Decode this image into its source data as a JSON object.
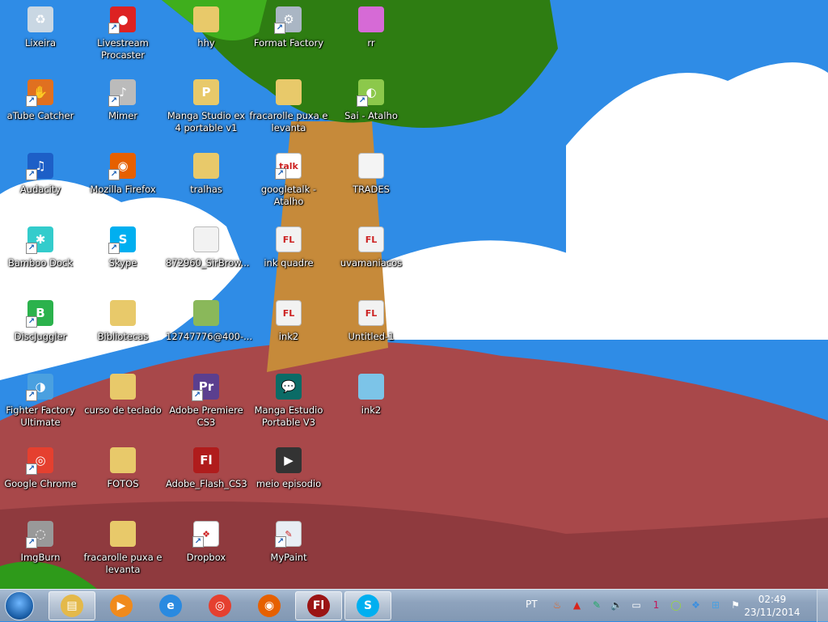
{
  "desktop": {
    "icons": [
      {
        "label": "Lixeira",
        "name": "recycle-bin",
        "color": "#c9d7e3",
        "glyph": "♻",
        "shortcut": false,
        "col": 0,
        "row": 0
      },
      {
        "label": "Livestream Procaster",
        "name": "livestream-procaster",
        "color": "#d22",
        "glyph": "●",
        "shortcut": true,
        "col": 1,
        "row": 0
      },
      {
        "label": "hhy",
        "name": "folder-hhy",
        "color": "#e8c96a",
        "glyph": "",
        "shortcut": false,
        "col": 2,
        "row": 0
      },
      {
        "label": "Format Factory",
        "name": "format-factory",
        "color": "#aab6c4",
        "glyph": "⚙",
        "shortcut": true,
        "col": 3,
        "row": 0
      },
      {
        "label": "rr",
        "name": "image-rr",
        "color": "#d66ad6",
        "glyph": "",
        "shortcut": false,
        "col": 4,
        "row": 0
      },
      {
        "label": "aTube Catcher",
        "name": "atube-catcher",
        "color": "#e07020",
        "glyph": "✋",
        "shortcut": true,
        "col": 0,
        "row": 1
      },
      {
        "label": "Mimer",
        "name": "mimer",
        "color": "#bbb",
        "glyph": "♪",
        "shortcut": true,
        "col": 1,
        "row": 1
      },
      {
        "label": "Manga Studio ex 4 portable v1",
        "name": "folder-manga-studio",
        "color": "#e8c96a",
        "glyph": "P",
        "shortcut": false,
        "col": 2,
        "row": 1
      },
      {
        "label": "fracarolle puxa e levanta",
        "name": "zip-fracarolle",
        "color": "#e8c96a",
        "glyph": "",
        "shortcut": false,
        "col": 3,
        "row": 1
      },
      {
        "label": "Sai - Atalho",
        "name": "sai-shortcut",
        "color": "#8cc84b",
        "glyph": "◐",
        "shortcut": true,
        "col": 4,
        "row": 1
      },
      {
        "label": "Audacity",
        "name": "audacity",
        "color": "#1d5fc7",
        "glyph": "♫",
        "shortcut": true,
        "col": 0,
        "row": 2
      },
      {
        "label": "Mozilla Firefox",
        "name": "mozilla-firefox",
        "color": "#e66000",
        "glyph": "◉",
        "shortcut": true,
        "col": 1,
        "row": 2
      },
      {
        "label": "tralhas",
        "name": "folder-tralhas",
        "color": "#e8c96a",
        "glyph": "",
        "shortcut": false,
        "col": 2,
        "row": 2
      },
      {
        "label": "googletalk - Atalho",
        "name": "googletalk-shortcut",
        "color": "#fff",
        "glyph": "talk",
        "shortcut": true,
        "col": 3,
        "row": 2
      },
      {
        "label": "TRADES",
        "name": "text-trades",
        "color": "#f4f4f4",
        "glyph": "",
        "shortcut": false,
        "col": 4,
        "row": 2
      },
      {
        "label": "Bamboo Dock",
        "name": "bamboo-dock",
        "color": "#3cc",
        "glyph": "✱",
        "shortcut": true,
        "col": 0,
        "row": 3
      },
      {
        "label": "Skype",
        "name": "skype",
        "color": "#00aff0",
        "glyph": "S",
        "shortcut": true,
        "col": 1,
        "row": 3
      },
      {
        "label": "872960_SirBrow...",
        "name": "image-872960",
        "color": "#f2f2f2",
        "glyph": "",
        "shortcut": false,
        "col": 2,
        "row": 3
      },
      {
        "label": "ink quadre",
        "name": "fla-ink-quadre",
        "color": "#f2f2f2",
        "glyph": "FL",
        "shortcut": false,
        "col": 3,
        "row": 3
      },
      {
        "label": "uvamaniacos",
        "name": "fla-uvamaniacos",
        "color": "#f2f2f2",
        "glyph": "FL",
        "shortcut": false,
        "col": 4,
        "row": 3
      },
      {
        "label": "DiscJuggler",
        "name": "discjuggler",
        "color": "#2bb24c",
        "glyph": "B",
        "shortcut": true,
        "col": 0,
        "row": 4
      },
      {
        "label": "Bibliotecas",
        "name": "folder-bibliotecas",
        "color": "#e8c96a",
        "glyph": "",
        "shortcut": false,
        "col": 1,
        "row": 4
      },
      {
        "label": "12747776@400-...",
        "name": "image-12747776",
        "color": "#8ab85a",
        "glyph": "",
        "shortcut": false,
        "col": 2,
        "row": 4
      },
      {
        "label": "ink2",
        "name": "fla-ink2",
        "color": "#f2f2f2",
        "glyph": "FL",
        "shortcut": false,
        "col": 3,
        "row": 4
      },
      {
        "label": "Untitled-1",
        "name": "fla-untitled-1",
        "color": "#f2f2f2",
        "glyph": "FL",
        "shortcut": false,
        "col": 4,
        "row": 4
      },
      {
        "label": "Fighter Factory Ultimate",
        "name": "fighter-factory-ultimate",
        "color": "#4aa0e0",
        "glyph": "◑",
        "shortcut": true,
        "col": 0,
        "row": 5
      },
      {
        "label": "curso de teclado",
        "name": "folder-curso-de-teclado",
        "color": "#e8c96a",
        "glyph": "",
        "shortcut": false,
        "col": 1,
        "row": 5
      },
      {
        "label": "Adobe Premiere CS3",
        "name": "adobe-premiere-cs3",
        "color": "#5b3f8f",
        "glyph": "Pr",
        "shortcut": true,
        "col": 2,
        "row": 5
      },
      {
        "label": "Manga Estudio Portable V3",
        "name": "manga-estudio-portable",
        "color": "#0b6b66",
        "glyph": "💬",
        "shortcut": false,
        "col": 3,
        "row": 5
      },
      {
        "label": "ink2",
        "name": "image-ink2",
        "color": "#7cc4e8",
        "glyph": "",
        "shortcut": false,
        "col": 4,
        "row": 5
      },
      {
        "label": "Google Chrome",
        "name": "google-chrome",
        "color": "#e5402f",
        "glyph": "◎",
        "shortcut": true,
        "col": 0,
        "row": 6
      },
      {
        "label": "FOTOS",
        "name": "folder-fotos",
        "color": "#e8c96a",
        "glyph": "",
        "shortcut": false,
        "col": 1,
        "row": 6
      },
      {
        "label": "Adobe_Flash_CS3",
        "name": "adobe-flash-cs3-installer",
        "color": "#b01c1c",
        "glyph": "Fl",
        "shortcut": false,
        "col": 2,
        "row": 6
      },
      {
        "label": "meio episodio",
        "name": "video-meio-episodio",
        "color": "#333",
        "glyph": "▶",
        "shortcut": false,
        "col": 3,
        "row": 6
      },
      {
        "label": "ImgBurn",
        "name": "imgburn",
        "color": "#999",
        "glyph": "◌",
        "shortcut": true,
        "col": 0,
        "row": 7
      },
      {
        "label": "fracarolle puxa e levanta",
        "name": "folder-fracarolle",
        "color": "#e8c96a",
        "glyph": "",
        "shortcut": false,
        "col": 1,
        "row": 7
      },
      {
        "label": "Dropbox",
        "name": "dropbox",
        "color": "#fff",
        "glyph": "❖",
        "shortcut": true,
        "col": 2,
        "row": 7
      },
      {
        "label": "MyPaint",
        "name": "mypaint",
        "color": "#e8eef4",
        "glyph": "✎",
        "shortcut": true,
        "col": 3,
        "row": 7
      }
    ]
  },
  "taskbar": {
    "pinned": [
      {
        "name": "windows-explorer",
        "glyph": "▤",
        "color": "#e4b94a",
        "active": true
      },
      {
        "name": "windows-media-player",
        "glyph": "▶",
        "color": "#f08a1c",
        "active": false
      },
      {
        "name": "internet-explorer",
        "glyph": "e",
        "color": "#2a8ae0",
        "active": false
      },
      {
        "name": "google-chrome",
        "glyph": "◎",
        "color": "#e5402f",
        "active": false
      },
      {
        "name": "mozilla-firefox",
        "glyph": "◉",
        "color": "#e66000",
        "active": false
      },
      {
        "name": "adobe-flash",
        "glyph": "Fl",
        "color": "#9b1414",
        "active": true
      },
      {
        "name": "skype",
        "glyph": "S",
        "color": "#00aff0",
        "active": true
      }
    ],
    "language": "PT",
    "tray": [
      {
        "name": "java-update-icon",
        "glyph": "♨",
        "color": "#e5621e"
      },
      {
        "name": "warning-icon",
        "glyph": "▲",
        "color": "#d9241b"
      },
      {
        "name": "tablet-pen-icon",
        "glyph": "✎",
        "color": "#2a6"
      },
      {
        "name": "volume-icon",
        "glyph": "🔈",
        "color": "#fff"
      },
      {
        "name": "network-icon",
        "glyph": "▭",
        "color": "#fff"
      },
      {
        "name": "bamboo-notification-icon",
        "glyph": "1",
        "color": "#c3185a"
      },
      {
        "name": "lime-icon",
        "glyph": "◯",
        "color": "#9ad83a"
      },
      {
        "name": "dropbox-icon",
        "glyph": "❖",
        "color": "#3b8fe0"
      },
      {
        "name": "windows-update-icon",
        "glyph": "⊞",
        "color": "#4aa0e0"
      },
      {
        "name": "action-center-flag-icon",
        "glyph": "⚑",
        "color": "#fff"
      }
    ],
    "time": "02:49",
    "date": "23/11/2014"
  }
}
